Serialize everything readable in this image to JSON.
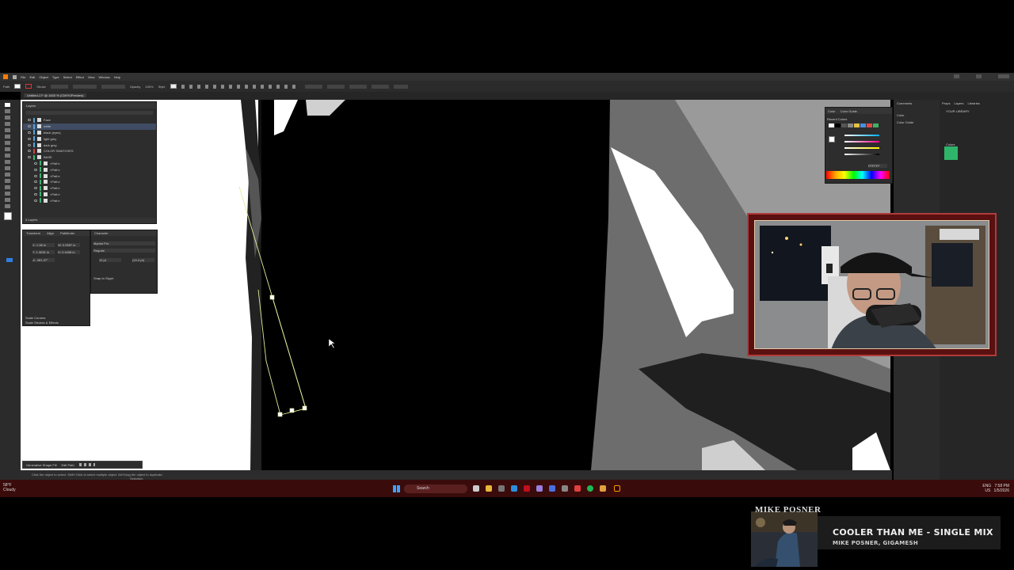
{
  "app": {
    "menu": [
      "File",
      "Edit",
      "Object",
      "Type",
      "Select",
      "Effect",
      "View",
      "Window",
      "Help"
    ],
    "control_bar": {
      "label": "Path",
      "stroke_label": "Stroke",
      "opacity_label": "Opacity",
      "opacity_value": "100%",
      "style_label": "Style"
    },
    "document_tab": "Untitled-17* @ 1600 % (CMYK/Preview)",
    "status_text": "Click the object to select. Shift+Click to select multiple object. Alt+Drag the object to duplicate.",
    "status_right": "Selection"
  },
  "layers_panel": {
    "title": "Layers",
    "rows": [
      {
        "name": "Face",
        "color": "#4fa3e0",
        "selected": false
      },
      {
        "name": "white",
        "color": "#4fa3e0",
        "selected": true
      },
      {
        "name": "black (eyes)",
        "color": "#4fa3e0",
        "selected": false
      },
      {
        "name": "light grey",
        "color": "#4fa3e0",
        "selected": false
      },
      {
        "name": "dark grey",
        "color": "#4fa3e0",
        "selected": false
      },
      {
        "name": "COLOR SWATCHES",
        "color": "#d04040",
        "selected": false
      },
      {
        "name": "BASE",
        "color": "#3cb06a",
        "selected": false
      },
      {
        "name": "<Path>",
        "color": "#3cb06a",
        "selected": false
      },
      {
        "name": "<Path>",
        "color": "#3cb06a",
        "selected": false
      },
      {
        "name": "<Path>",
        "color": "#3cb06a",
        "selected": false
      },
      {
        "name": "<Path>",
        "color": "#3cb06a",
        "selected": false
      },
      {
        "name": "<Path>",
        "color": "#3cb06a",
        "selected": false
      },
      {
        "name": "<Path>",
        "color": "#3cb06a",
        "selected": false
      },
      {
        "name": "<Path>",
        "color": "#3cb06a",
        "selected": false
      }
    ],
    "footer": "4 Layers"
  },
  "transform_panel": {
    "tabs": [
      "Transform",
      "Align",
      "Pathfinder"
    ],
    "fields": [
      "X: 1.38 in",
      "W: 0.0557 in",
      "Y: 1.3631 in",
      "H: 0.4438 in",
      "∠: 281.37°"
    ],
    "checkboxes": [
      "Scale Corners",
      "Scale Strokes & Effects"
    ]
  },
  "character_panel": {
    "title": "Character",
    "font": "Myriad Pro",
    "style": "Regular",
    "size": "12 pt",
    "leading": "(14.4 pt)",
    "snap_label": "Snap to Glyph"
  },
  "color_panel": {
    "tabs": [
      "Color",
      "Color Guide"
    ],
    "hex": "FFFFFF",
    "recent_colors_label": "Recent Colors",
    "recent_colors": [
      "#ffffff",
      "#000000",
      "#555555",
      "#888888",
      "#e8c040",
      "#4a90e0",
      "#e04848",
      "#40b060"
    ]
  },
  "comments_dock": [
    "Comments",
    "Color",
    "Color Guide"
  ],
  "library_dock": {
    "tabs": [
      "Props",
      "Layers",
      "Libraries"
    ],
    "title": "YOUR LIBRARY",
    "section": "Colors",
    "swatch": "#2fb56a"
  },
  "context_bar": {
    "items": [
      "Generative Shape Fill",
      "Edit Path"
    ]
  },
  "taskbar": {
    "weather_temp": "58°F",
    "weather_text": "Cloudy",
    "search_placeholder": "Search",
    "lang": "ENG",
    "region": "US",
    "time": "7:58 PM",
    "date": "1/5/2026"
  },
  "now_playing": {
    "label": "MIKE POSNER",
    "song": "COOLER THAN ME - SINGLE MIX",
    "artist": "MIKE POSNER, GIGAMESH"
  }
}
